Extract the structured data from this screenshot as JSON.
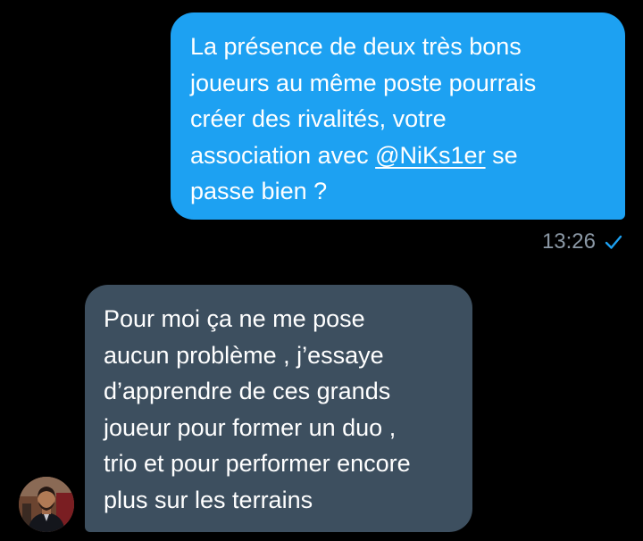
{
  "sent_message": {
    "lines": [
      "La présence de deux très bons",
      "joueurs au même poste pourrais",
      "créer des rivalités, votre"
    ],
    "line4_before": "association avec ",
    "mention": "@NiKs1er",
    "line4_after": " se",
    "line5": "passe bien ?",
    "timestamp": "13:26",
    "status_icon": "check-icon",
    "bubble_color": "#1da1f2"
  },
  "received_message": {
    "lines": [
      "Pour moi ça ne me pose",
      "aucun problème , j’essaye",
      "d’apprendre de ces grands",
      "joueur pour former un duo ,",
      "trio et pour performer encore",
      "plus sur les terrains"
    ],
    "bubble_color": "#3d4f5f"
  },
  "theme": {
    "background": "#000000",
    "timestamp_color": "#8b98a5",
    "accent": "#1da1f2"
  }
}
